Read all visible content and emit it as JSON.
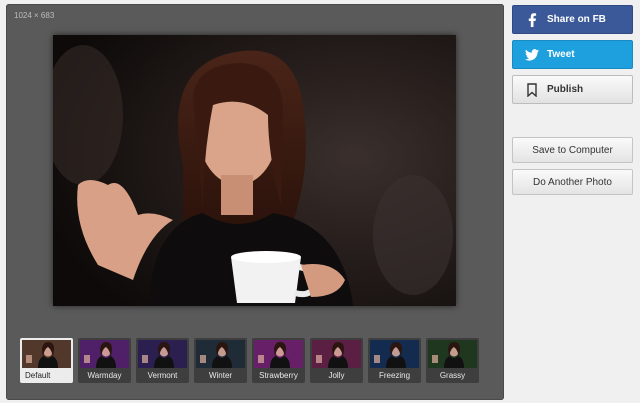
{
  "editor": {
    "dimensions": "1024 × 683"
  },
  "filters": [
    {
      "name": "Default",
      "tint": "#6e4a3a",
      "active": true
    },
    {
      "name": "Warmday",
      "tint": "#6a2a8a",
      "active": false
    },
    {
      "name": "Vermont",
      "tint": "#3a2a6a",
      "active": false
    },
    {
      "name": "Winter",
      "tint": "#2a3a4a",
      "active": false
    },
    {
      "name": "Strawberry",
      "tint": "#8a2a8a",
      "active": false
    },
    {
      "name": "Jolly",
      "tint": "#7a2a5a",
      "active": false
    },
    {
      "name": "Freezing",
      "tint": "#1a3a6a",
      "active": false
    },
    {
      "name": "Grassy",
      "tint": "#2a4a2a",
      "active": false
    }
  ],
  "actions": {
    "share_fb": "Share on FB",
    "tweet": "Tweet",
    "publish": "Publish",
    "save": "Save to Computer",
    "again": "Do Another Photo"
  },
  "colors": {
    "facebook": "#3b5998",
    "twitter": "#1ea0de",
    "editor_bg": "#5a5a5a",
    "page_bg": "#f0f0f0"
  },
  "icons": {
    "facebook": "facebook-icon",
    "twitter": "twitter-bird-icon",
    "publish": "bookmark-icon"
  }
}
